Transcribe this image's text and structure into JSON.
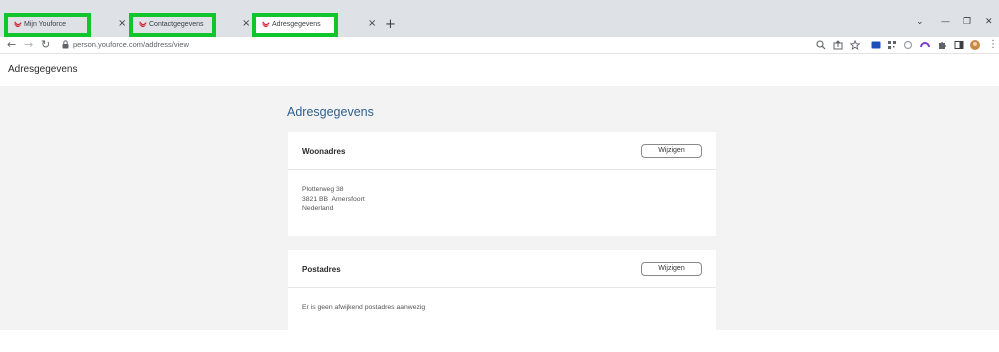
{
  "browser": {
    "tabs": [
      {
        "label": "Mijn Youforce"
      },
      {
        "label": "Contactgegevens"
      },
      {
        "label": "Adresgegevens"
      }
    ],
    "url": "person.youforce.com/address/view",
    "new_tab": "+",
    "close_glyph": "×"
  },
  "app": {
    "title": "Adresgegevens"
  },
  "page": {
    "title": "Adresgegevens",
    "woonadres": {
      "title": "Woonadres",
      "button": "Wijzigen",
      "lines": [
        "Plotterweg 38",
        "3821 BB  Amersfoort",
        "Nederland"
      ]
    },
    "postadres": {
      "title": "Postadres",
      "button": "Wijzigen",
      "empty_text": "Er is geen afwijkend postadres aanwezig"
    }
  },
  "colors": {
    "highlight": "#11c62c",
    "title_blue": "#2e5f8f",
    "favicon": "#d0192b"
  }
}
